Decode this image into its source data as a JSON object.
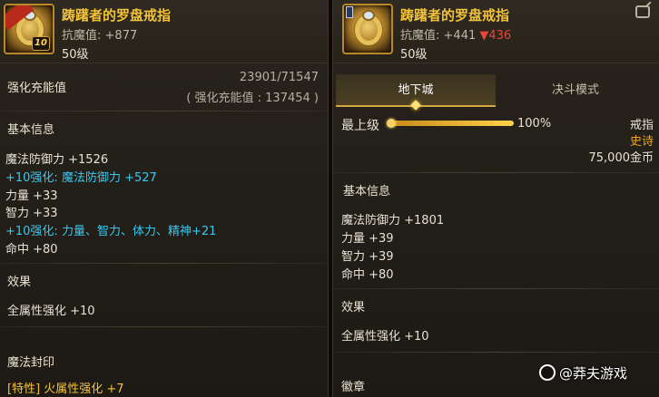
{
  "left": {
    "item": {
      "name": "踌躇者的罗盘戒指",
      "resist_label": "抗魔值:",
      "resist_value": "+877",
      "level": "50级",
      "badge_level": "10",
      "icon": "compass-ring-icon"
    },
    "enhance": {
      "label": "强化充能值",
      "value": "23901/71547",
      "note": "( 强化充能值 : 137454 )"
    },
    "basic": {
      "title": "基本信息",
      "stats": [
        {
          "text": "魔法防御力 +1526",
          "color": "white"
        },
        {
          "text": "+10强化: 魔法防御力 +527",
          "color": "blue"
        },
        {
          "text": "力量 +33",
          "color": "white"
        },
        {
          "text": "智力 +33",
          "color": "white"
        },
        {
          "text": "+10强化: 力量、智力、体力、精神+21",
          "color": "blue"
        },
        {
          "text": "命中 +80",
          "color": "white"
        }
      ]
    },
    "effect": {
      "title": "效果",
      "text": "全属性强化 +10"
    },
    "seal": {
      "title": "魔法封印",
      "text": "[特性] 火属性强化 +7"
    }
  },
  "right": {
    "item": {
      "name": "踌躇者的罗盘戒指",
      "resist_label": "抗魔值:",
      "resist_value": "+441",
      "resist_diff": "▼436",
      "level": "50级",
      "icon": "compass-ring-icon"
    },
    "tabs": [
      {
        "label": "地下城",
        "active": true
      },
      {
        "label": "决斗模式",
        "active": false
      }
    ],
    "grade": {
      "label": "最上级",
      "percent": "100%",
      "fill": 1.0,
      "slot": "戒指",
      "rarity": "史诗",
      "price": "75,000金币"
    },
    "basic": {
      "title": "基本信息",
      "stats": [
        "魔法防御力 +1801",
        "力量 +39",
        "智力 +39",
        "命中 +80"
      ]
    },
    "effect": {
      "title": "效果",
      "text": "全属性强化 +10"
    },
    "emblem": {
      "title": "徽章"
    }
  },
  "watermark": "@莽夫游戏",
  "colors": {
    "gold": "#f2c23a",
    "blue": "#38c8f0",
    "red": "#e8463a",
    "rarity": "#f2a81a"
  }
}
